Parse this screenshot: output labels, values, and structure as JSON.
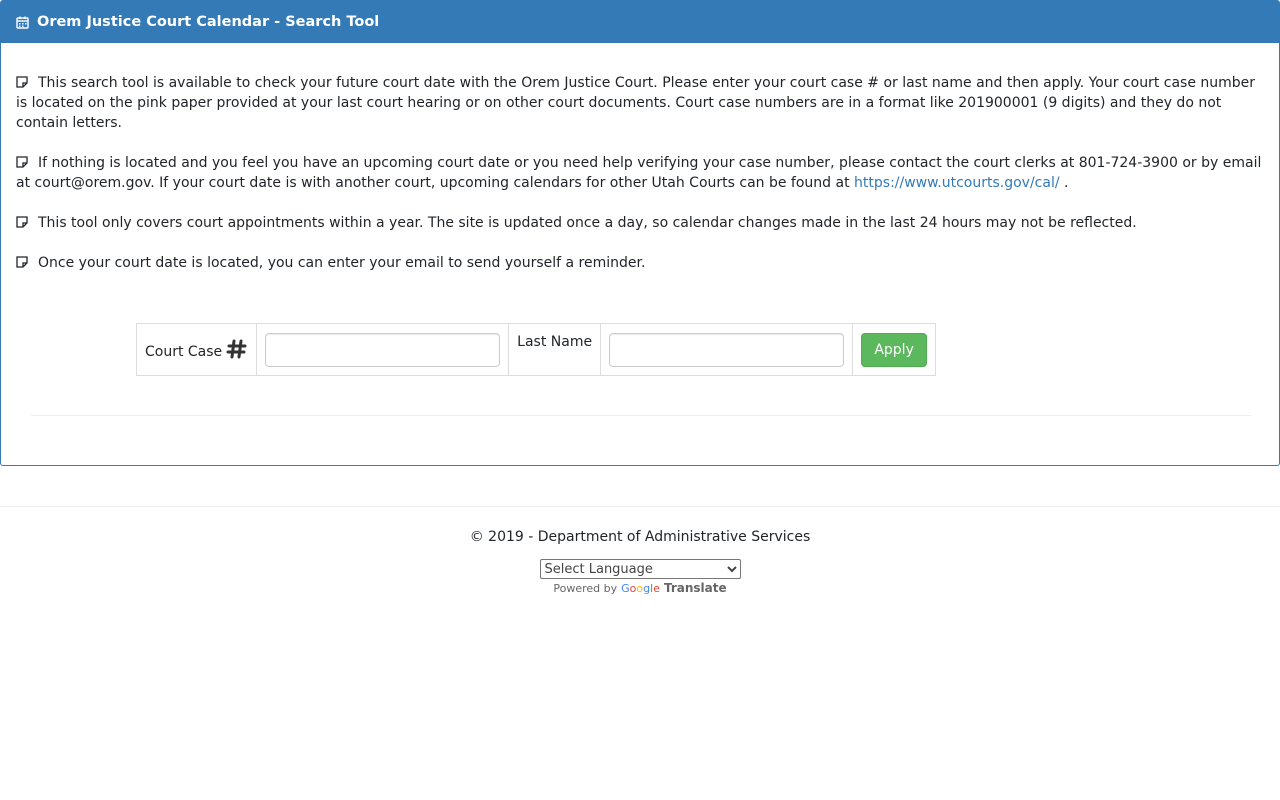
{
  "header": {
    "title": "Orem Justice Court Calendar - Search Tool",
    "icon": "calendar-icon"
  },
  "info": {
    "p1": "This search tool is available to check your future court date with the Orem Justice Court. Please enter your court case # or last name and then apply. Your court case number is located on the pink paper provided at your last court hearing or on other court documents. Court case numbers are in a format like 201900001 (9 digits) and they do not contain letters.",
    "p2_before": "If nothing is located and you feel you have an upcoming court date or you need help verifying your case number, please contact the court clerks at 801-724-3900 or by email at court@orem.gov. If your court date is with another court, upcoming calendars for other Utah Courts can be found at ",
    "p2_link": "https://www.utcourts.gov/cal/",
    "p2_after": " .",
    "p3": "This tool only covers court appointments within a year. The site is updated once a day, so calendar changes made in the last 24 hours may not be reflected.",
    "p4": "Once your court date is located, you can enter your email to send yourself a reminder."
  },
  "search": {
    "court_case_label": "Court Case",
    "court_case_value": "",
    "last_name_label": "Last Name",
    "last_name_value": "",
    "apply_label": "Apply"
  },
  "footer": {
    "copyright": "© 2019 - Department of Administrative Services",
    "language_selected": "Select Language",
    "powered_by": "Powered by",
    "google": "Google",
    "translate": "Translate"
  },
  "colors": {
    "header_bg": "#337ab7",
    "apply_bg": "#5cb85c",
    "link": "#337ab7"
  }
}
